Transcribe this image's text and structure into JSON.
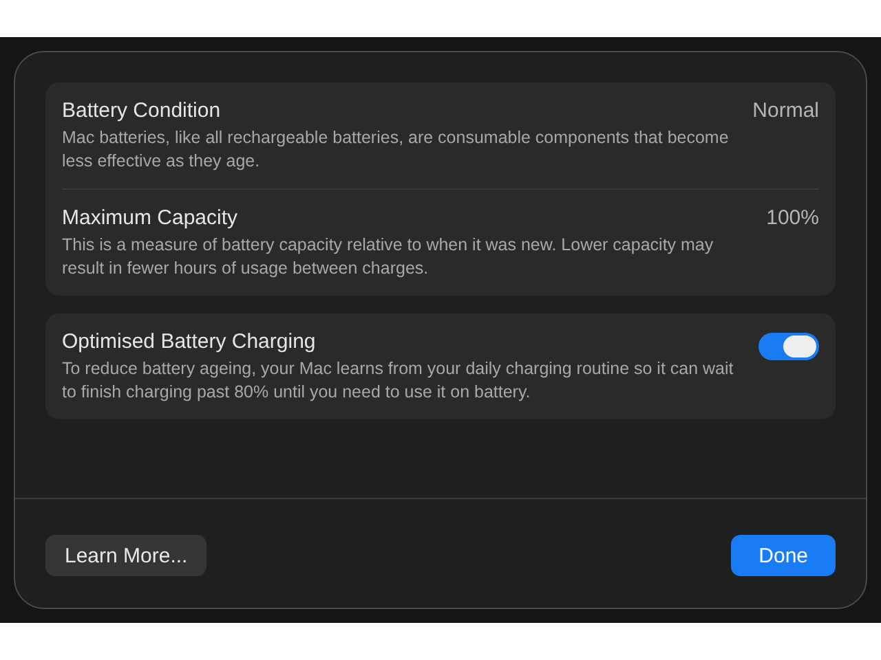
{
  "groups": [
    {
      "rows": [
        {
          "kind": "value",
          "title": "Battery Condition",
          "value": "Normal",
          "description": "Mac batteries, like all rechargeable batteries, are consumable components that become less effective as they age."
        },
        {
          "kind": "value",
          "title": "Maximum Capacity",
          "value": "100%",
          "description": "This is a measure of battery capacity relative to when it was new. Lower capacity may result in fewer hours of usage between charges."
        }
      ]
    },
    {
      "rows": [
        {
          "kind": "toggle",
          "title": "Optimised Battery Charging",
          "on": true,
          "description": "To reduce battery ageing, your Mac learns from your daily charging routine so it can wait to finish charging past 80% until you need to use it on battery."
        }
      ]
    }
  ],
  "buttons": [
    {
      "label": "Learn More...",
      "kind": "secondary"
    },
    {
      "label": "Done",
      "kind": "primary"
    }
  ]
}
